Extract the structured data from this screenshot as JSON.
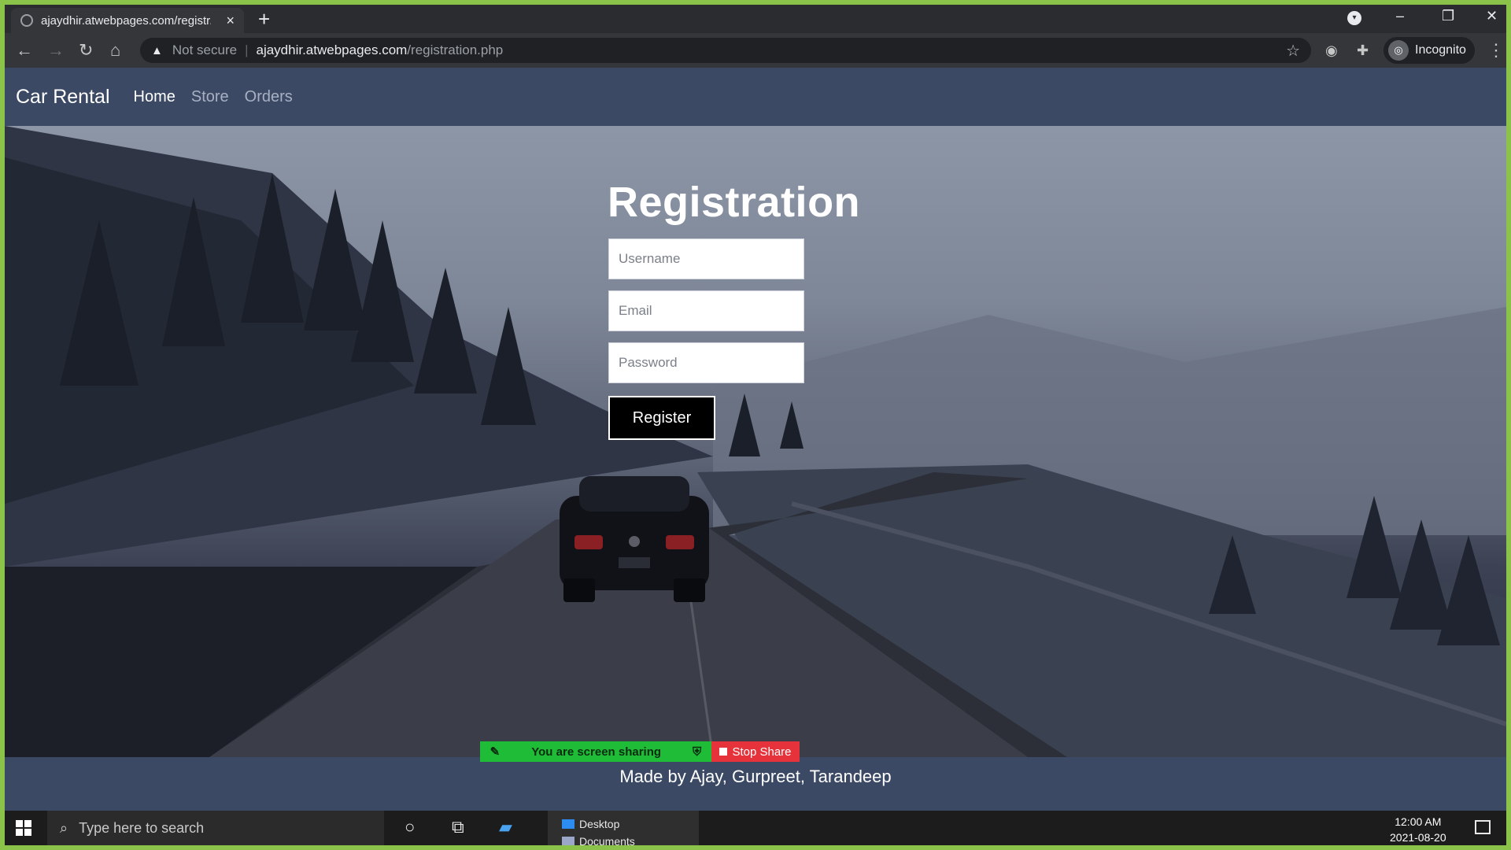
{
  "browser": {
    "tab_title": "ajaydhir.atwebpages.com/registr...",
    "new_tab": "+",
    "close_tab": "×",
    "security_label": "Not secure",
    "url_host": "ajaydhir.atwebpages.com",
    "url_path": "/registration.php",
    "profile_label": "Incognito"
  },
  "site": {
    "brand": "Car Rental",
    "nav": [
      {
        "label": "Home",
        "active": true
      },
      {
        "label": "Store",
        "active": false
      },
      {
        "label": "Orders",
        "active": false
      }
    ],
    "form": {
      "title": "Registration",
      "username_placeholder": "Username",
      "email_placeholder": "Email",
      "password_placeholder": "Password",
      "submit_label": "Register"
    },
    "footer_text": "Made by Ajay, Gurpreet, Tarandeep"
  },
  "screen_share": {
    "status": "You are screen sharing",
    "stop_label": "Stop Share"
  },
  "taskbar": {
    "search_placeholder": "Type here to search",
    "popup_items": [
      "Desktop",
      "Documents"
    ],
    "time": "12:00 AM",
    "date": "2021-08-20"
  },
  "colors": {
    "navbar": "#3b4965",
    "share_green": "#1fbd37",
    "share_red": "#e5323b",
    "outer_border": "#8bc34a"
  }
}
